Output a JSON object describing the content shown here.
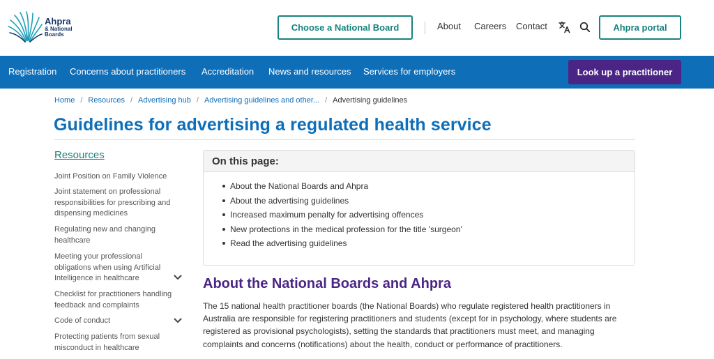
{
  "header": {
    "logo": {
      "name": "Ahpra",
      "line2": "& National",
      "line3": "Boards"
    },
    "choose_board": "Choose a National Board",
    "nav": [
      "About",
      "Careers",
      "Contact"
    ],
    "icons": [
      "translate-icon",
      "search-icon"
    ],
    "portal": "Ahpra portal"
  },
  "main_nav": {
    "items": [
      "Registration",
      "Concerns about practitioners",
      "Accreditation",
      "News and resources",
      "Services for employers"
    ],
    "lookup": "Look up a practitioner"
  },
  "breadcrumb": {
    "items": [
      "Home",
      "Resources",
      "Advertising hub",
      "Advertising guidelines and other..."
    ],
    "current": "Advertising guidelines"
  },
  "page_title": "Guidelines for advertising a regulated health service",
  "sidebar": {
    "heading": "Resources",
    "items": [
      "Joint Position on Family Violence",
      "Joint statement on professional responsibilities for prescribing and dispensing medicines",
      "Regulating new and changing healthcare",
      "Meeting your professional obligations when using Artificial Intelligence in healthcare",
      "Checklist for practitioners handling feedback and complaints",
      "Code of conduct",
      "Protecting patients from sexual misconduct in healthcare"
    ]
  },
  "on_this_page": {
    "heading": "On this page:",
    "items": [
      "About the National Boards and Ahpra",
      "About the advertising guidelines",
      "Increased maximum penalty for advertising offences",
      "New protections in the medical profession for the title 'surgeon'",
      "Read the advertising guidelines"
    ]
  },
  "section": {
    "title": "About the National Boards and Ahpra",
    "paragraph": "The 15 national health practitioner boards (the National Boards) who regulate registered health practitioners in Australia are responsible for registering practitioners and students (except for in psychology, where students are registered as provisional psychologists), setting the standards that practitioners must meet, and managing complaints and concerns (notifications) about the health, conduct or performance of practitioners."
  },
  "colors": {
    "teal": "#17827e",
    "blue": "#0e6eb8",
    "purple": "#4a2585"
  }
}
